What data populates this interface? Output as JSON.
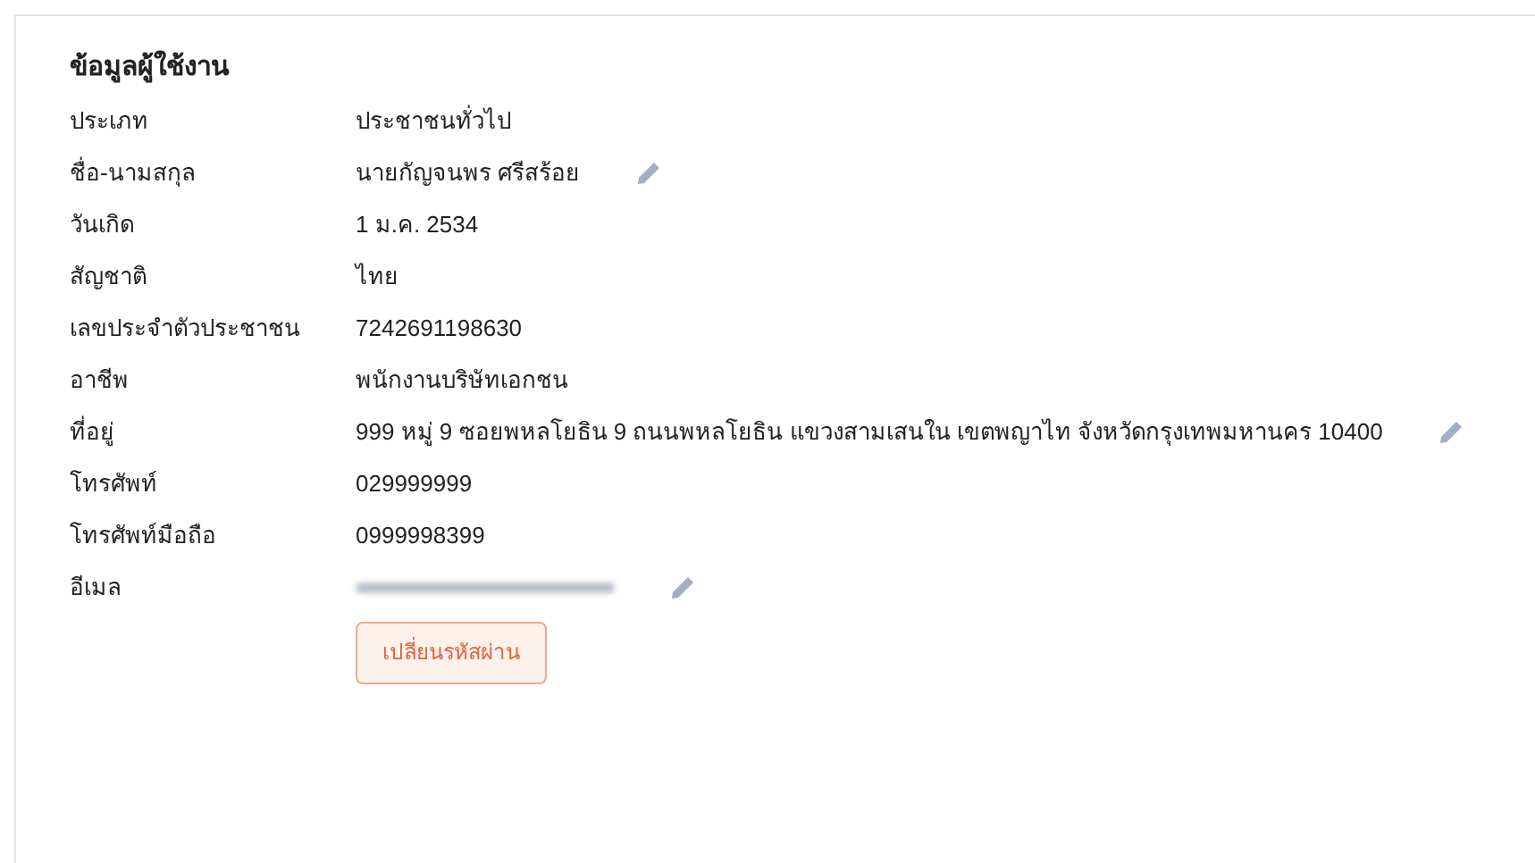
{
  "section": {
    "title": "ข้อมูลผู้ใช้งาน"
  },
  "fields": [
    {
      "label": "ประเภท",
      "kind": "text",
      "value": "ประชาชนทั่วไป",
      "editable": false
    },
    {
      "label": "ชื่อ-นามสกุล",
      "kind": "text",
      "value": "นายกัญจนพร ศรีสร้อย",
      "editable": true
    },
    {
      "label": "วันเกิด",
      "kind": "text",
      "value": "1 ม.ค. 2534",
      "editable": false
    },
    {
      "label": "สัญชาติ",
      "kind": "text",
      "value": "ไทย",
      "editable": false
    },
    {
      "label": "เลขประจำตัวประชาชน",
      "kind": "text",
      "value": "7242691198630",
      "editable": false
    },
    {
      "label": "อาชีพ",
      "kind": "text",
      "value": "พนักงานบริษัทเอกชน",
      "editable": false
    },
    {
      "label": "ที่อยู่",
      "kind": "text",
      "value": "999 หมู่ 9 ซอยพหลโยธิน 9 ถนนพหลโยธิน แขวงสามเสนใน เขตพญาไท จังหวัดกรุงเทพมหานคร 10400",
      "editable": true
    },
    {
      "label": "โทรศัพท์",
      "kind": "text",
      "value": "029999999",
      "editable": false
    },
    {
      "label": "โทรศัพท์มือถือ",
      "kind": "text",
      "value": "0999998399",
      "editable": false
    },
    {
      "label": "อีเมล",
      "kind": "redacted",
      "editable": true
    }
  ],
  "button": {
    "label": "เปลี่ยนรหัสผ่าน"
  }
}
